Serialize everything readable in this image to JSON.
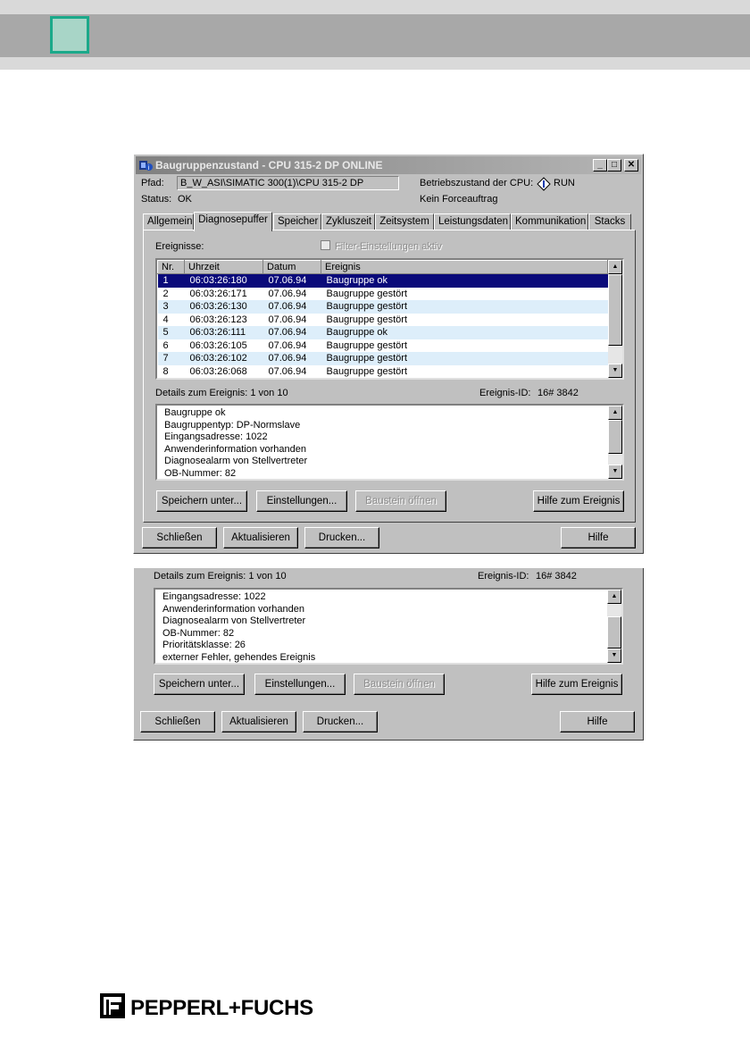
{
  "dialog": {
    "title": "Baugruppenzustand - CPU 315-2 DP  ONLINE",
    "path_label": "Pfad:",
    "path_value": "B_W_ASI\\SIMATIC 300(1)\\CPU 315-2 DP",
    "status_label": "Status:",
    "status_value": "OK",
    "cpu_state_label": "Betriebszustand der CPU:",
    "cpu_state_value": "RUN",
    "force_text": "Kein Forceauftrag",
    "tabs": [
      "Allgemein",
      "Diagnosepuffer",
      "Speicher",
      "Zykluszeit",
      "Zeitsystem",
      "Leistungsdaten",
      "Kommunikation",
      "Stacks"
    ],
    "active_tab": "Diagnosepuffer",
    "events_label": "Ereignisse:",
    "filter_label": "Filter-Einstellungen aktiv",
    "table": {
      "columns": [
        "Nr.",
        "Uhrzeit",
        "Datum",
        "Ereignis"
      ],
      "rows": [
        [
          "1",
          "06:03:26:180",
          "07.06.94",
          "Baugruppe ok"
        ],
        [
          "2",
          "06:03:26:171",
          "07.06.94",
          "Baugruppe gestört"
        ],
        [
          "3",
          "06:03:26:130",
          "07.06.94",
          "Baugruppe gestört"
        ],
        [
          "4",
          "06:03:26:123",
          "07.06.94",
          "Baugruppe gestört"
        ],
        [
          "5",
          "06:03:26:111",
          "07.06.94",
          "Baugruppe ok"
        ],
        [
          "6",
          "06:03:26:105",
          "07.06.94",
          "Baugruppe gestört"
        ],
        [
          "7",
          "06:03:26:102",
          "07.06.94",
          "Baugruppe gestört"
        ],
        [
          "8",
          "06:03:26:068",
          "07.06.94",
          "Baugruppe gestört"
        ]
      ]
    },
    "details_label": "Details zum Ereignis:  1 von 10",
    "event_id_label": "Ereignis-ID:",
    "event_id_value": "16# 3842",
    "details_lines": [
      "Baugruppe ok",
      "Baugruppentyp: DP-Normslave",
      "Eingangsadresse:  1022",
      "Anwenderinformation vorhanden",
      "Diagnosealarm von Stellvertreter",
      "OB-Nummer:  82"
    ],
    "buttons": {
      "save_as": "Speichern unter...",
      "settings": "Einstellungen...",
      "open_block": "Baustein öffnen",
      "help_event": "Hilfe zum Ereignis",
      "close": "Schließen",
      "refresh": "Aktualisieren",
      "print": "Drucken...",
      "help": "Hilfe"
    }
  },
  "dialog2": {
    "details_label": "Details zum Ereignis:  1 von 10",
    "event_id_label": "Ereignis-ID:",
    "event_id_value": "16# 3842",
    "details_lines": [
      "Eingangsadresse:  1022",
      "Anwenderinformation vorhanden",
      "Diagnosealarm von Stellvertreter",
      "OB-Nummer:  82",
      "Prioritätsklasse: 26",
      "externer Fehler, gehendes Ereignis"
    ]
  },
  "footer": {
    "brand": "PEPPERL+FUCHS"
  },
  "colors": {
    "header_gray": "#a8a8a8",
    "accent_green": "#1ba98a",
    "selection": "#0a0a7a",
    "row_alt": "#ddeefa"
  }
}
